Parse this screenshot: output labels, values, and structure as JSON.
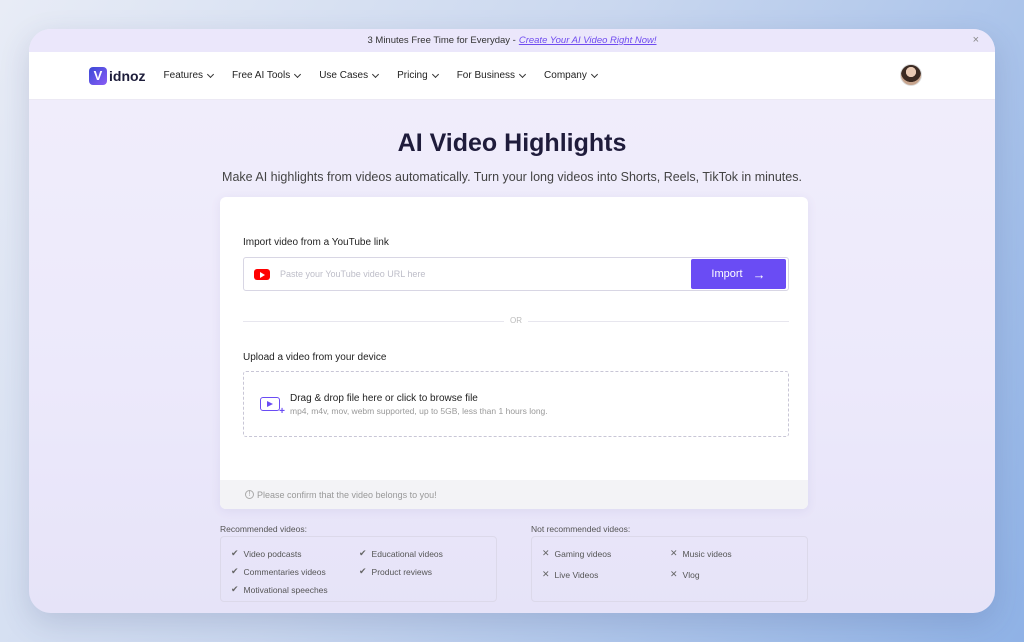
{
  "announcement": {
    "prefix": "3 Minutes",
    "bold": "Free Time for Everyday -",
    "link": "Create Your AI Video Right Now!",
    "close": "×"
  },
  "nav": {
    "logo_mark": "V",
    "logo_text": "idnoz",
    "items": [
      "Features",
      "Free AI Tools",
      "Use Cases",
      "Pricing",
      "For Business",
      "Company"
    ]
  },
  "hero": {
    "title": "AI Video Highlights",
    "subtitle": "Make AI highlights from videos automatically. Turn your long videos into Shorts, Reels, TikTok in minutes."
  },
  "card": {
    "import_label": "Import video from a YouTube link",
    "url_placeholder": "Paste your YouTube video URL here",
    "import_button": "Import",
    "or": "OR",
    "upload_label": "Upload a video from your device",
    "drop_title": "Drag & drop file here or click to browse file",
    "drop_sub": "mp4, m4v, mov, webm supported, up to 5GB, less than 1 hours long.",
    "confirm": "Please confirm that the video belongs to you!"
  },
  "recommended": {
    "title": "Recommended videos:",
    "items": [
      "Video podcasts",
      "Educational videos",
      "Commentaries videos",
      "Product reviews",
      "Motivational speeches"
    ]
  },
  "not_recommended": {
    "title": "Not recommended videos:",
    "items": [
      "Gaming videos",
      "Music videos",
      "Live Videos",
      "Vlog"
    ]
  }
}
